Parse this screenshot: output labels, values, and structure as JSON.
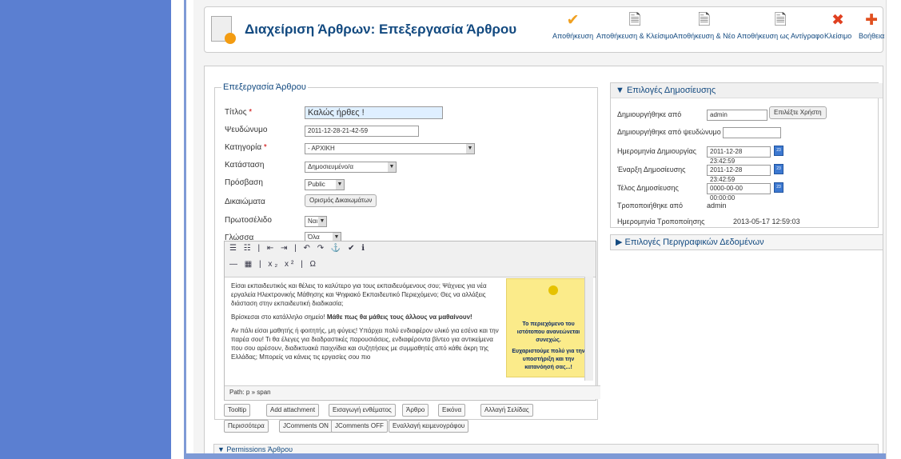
{
  "toolbar": {
    "title": "Διαχείριση Άρθρων: Επεξεργασία Άρθρου",
    "buttons": [
      {
        "label": "Αποθήκευση",
        "icon": "check-icon",
        "color": "#f0a020"
      },
      {
        "label": "Αποθήκευση & Κλείσιμο",
        "icon": "save-close-icon"
      },
      {
        "label": "Αποθήκευση & Νέο",
        "icon": "save-new-icon"
      },
      {
        "label": "Αποθήκευση ως Αντίγραφο",
        "icon": "save-copy-icon"
      },
      {
        "label": "Κλείσιμο",
        "icon": "close-icon",
        "color": "#e04020"
      },
      {
        "label": "Βοήθεια",
        "icon": "help-icon",
        "color": "#e05020"
      }
    ]
  },
  "edit": {
    "legend": "Επεξεργασία Άρθρου",
    "title_label": "Τίτλος",
    "title_value": "Καλώς ήρθες !",
    "alias_label": "Ψευδώνυμο",
    "alias_value": "2011-12-28-21-42-59",
    "category_label": "Κατηγορία",
    "category_value": "- ΑΡΧΙΚΗ",
    "state_label": "Κατάσταση",
    "state_value": "Δημοσιευμένο/α",
    "access_label": "Πρόσβαση",
    "access_value": "Public",
    "rights_label": "Δικαιώματα",
    "rights_button": "Ορισμός Δικαιωμάτων",
    "featured_label": "Πρωτοσέλιδο",
    "featured_value": "Ναι",
    "language_label": "Γλώσσα",
    "language_value": "Όλα"
  },
  "editor": {
    "p1": "Είσαι εκπαιδευτικός και θέλεις το καλύτερο για τους εκπαιδευόμενους σου; Ψάχνεις για νέα εργαλεία Ηλεκτρονικής Μάθησης και Ψηφιακό Εκπαιδευτικό Περιεχόμενο; Θες να αλλάξεις διάσταση στην εκπαιδευτική διαδικασία;",
    "p2a": "Βρίσκεσαι στο κατάλληλο σημείο! ",
    "p2b": "Μάθε πως θα μάθεις τους άλλους να μαθαίνουν!",
    "p3": "Αν πάλι είσαι μαθητής ή φοιτητής, μη φύγεις! Υπάρχει πολύ ενδιαφέρον υλικό για εσένα και την παρέα σου! Τι θα έλεγες για διαδραστικές παρουσιάσεις, ενδιαφέροντα βίντεο για αντικείμενα που σου αρέσουν, διαδικτυακά παιχνίδια και συζητήσεις με συμμαθητές από κάθε άκρη της Ελλάδας; Μπορείς να κάνεις τις εργασίες σου πιο",
    "note1": "Το περιεχόμενο του ιστότοπου ανανεώνεται συνεχώς.",
    "note2": "Ευχαριστούμε πολύ για την υποστήριξη και την κατανόησή σας...!",
    "path": "Path: p » span"
  },
  "editor_buttons": [
    "Tooltip",
    "Add attachment",
    "Εισαγωγή ενθέματος",
    "Άρθρο",
    "Εικόνα",
    "Αλλαγή Σελίδας",
    "Περισσότερα",
    "JComments ON",
    "JComments OFF",
    "Εναλλαγή κειμενογράφου"
  ],
  "publish": {
    "header": "▼ Επιλογές Δημοσίευσης",
    "created_by_label": "Δημιουργήθηκε από",
    "created_by_value": "admin",
    "select_user": "Επιλέξτε Χρήστη",
    "created_alias_label": "Δημιουργήθηκε από ψευδώνυμο",
    "created_date_label": "Ημερομηνία Δημιουργίας",
    "created_date_value": "2011-12-28 23:42:59",
    "publish_up_label": "Έναρξη Δημοσίευσης",
    "publish_up_value": "2011-12-28 23:42:59",
    "publish_down_label": "Τέλος Δημοσίευσης",
    "publish_down_value": "0000-00-00 00:00:00",
    "modified_by_label": "Τροποποιήθηκε από",
    "modified_by_value": "admin",
    "modified_date_label": "Ημερομηνία Τροποποίησης",
    "modified_date_value": "2013-05-17 12:59:03"
  },
  "metadata_header": "▶ Επιλογές Περιγραφικών Δεδομένων",
  "permissions_header": "▼ Permissions Άρθρου"
}
